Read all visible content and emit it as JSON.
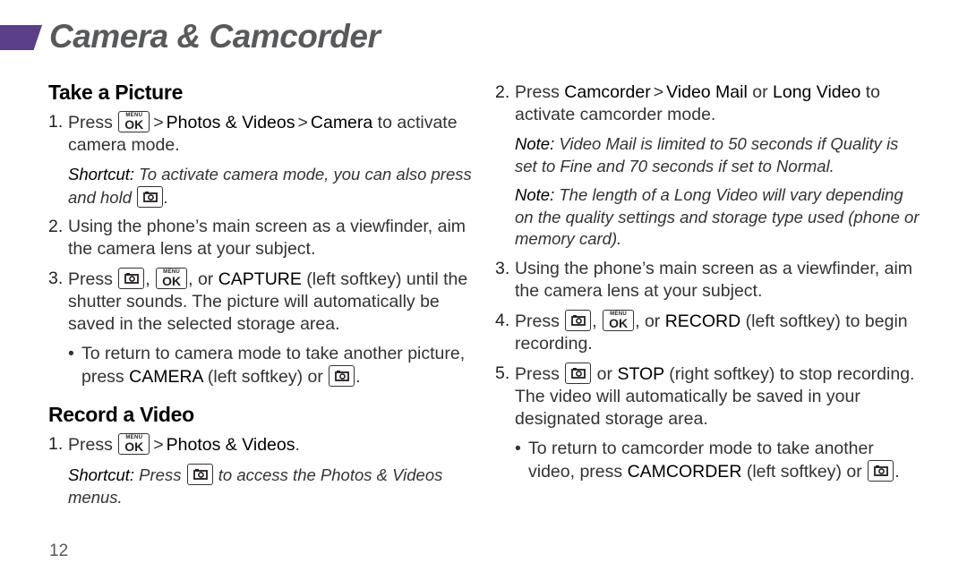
{
  "header": {
    "title": "Camera & Camcorder",
    "accent_color": "#5b3f87"
  },
  "left": {
    "section1": {
      "heading": "Take a Picture",
      "step1": {
        "num": "1.",
        "press": "Press",
        "path1": "Photos & Videos",
        "path2": "Camera",
        "rest": " to activate camera mode."
      },
      "shortcut1": {
        "label": "Shortcut:",
        "text": " To activate camera mode, you can also press and hold ",
        "end": "."
      },
      "step2": {
        "num": "2.",
        "text": "Using the phone’s main screen as a viewfinder, aim the camera lens at your subject."
      },
      "step3": {
        "num": "3.",
        "press": "Press ",
        "sep": ", ",
        "or": ", or ",
        "key": "CAPTURE",
        "rest": " (left softkey) until the shutter sounds. The picture will automatically be saved in the selected storage area."
      },
      "bullet1": {
        "dot": "•",
        "text": "To return to camera mode to take another picture, press ",
        "key": "CAMERA",
        "rest": " (left softkey) or ",
        "end": "."
      }
    },
    "section2": {
      "heading": "Record a Video",
      "step1": {
        "num": "1.",
        "press": "Press",
        "path1": "Photos & Videos",
        "end": "."
      },
      "shortcut": {
        "label": "Shortcut:",
        "pre": " Press ",
        "post": " to access the Photos & Videos menus."
      }
    }
  },
  "right": {
    "step2": {
      "num": "2.",
      "press": "Press ",
      "path1": "Camcorder",
      "path2": "Video Mail",
      "or": " or ",
      "path3": "Long Video",
      "rest": " to activate camcorder mode."
    },
    "note1": {
      "label": "Note:",
      "text": " Video Mail is limited to 50 seconds if Quality is set to Fine and 70 seconds if set to Normal."
    },
    "note2": {
      "label": "Note:",
      "text": " The length of a Long Video will vary depending on the quality settings and storage type used (phone or memory card)."
    },
    "step3": {
      "num": "3.",
      "text": "Using the phone’s main screen as a viewfinder, aim the camera lens at your subject."
    },
    "step4": {
      "num": "4.",
      "press": "Press ",
      "sep": ", ",
      "or": ", or ",
      "key": "RECORD",
      "rest": " (left softkey) to begin recording."
    },
    "step5": {
      "num": "5.",
      "press": "Press ",
      "or": " or ",
      "key": "STOP",
      "rest": " (right softkey) to stop recording. The video will automatically be saved in your designated storage area."
    },
    "bullet1": {
      "dot": "•",
      "text": "To return to camcorder mode to take another video, press ",
      "key": "CAMCORDER",
      "rest": " (left softkey) or ",
      "end": "."
    }
  },
  "icons": {
    "menu_key": {
      "top": "MENU",
      "bottom": "OK"
    },
    "arrow": ">"
  },
  "footer": {
    "page_number": "12"
  }
}
